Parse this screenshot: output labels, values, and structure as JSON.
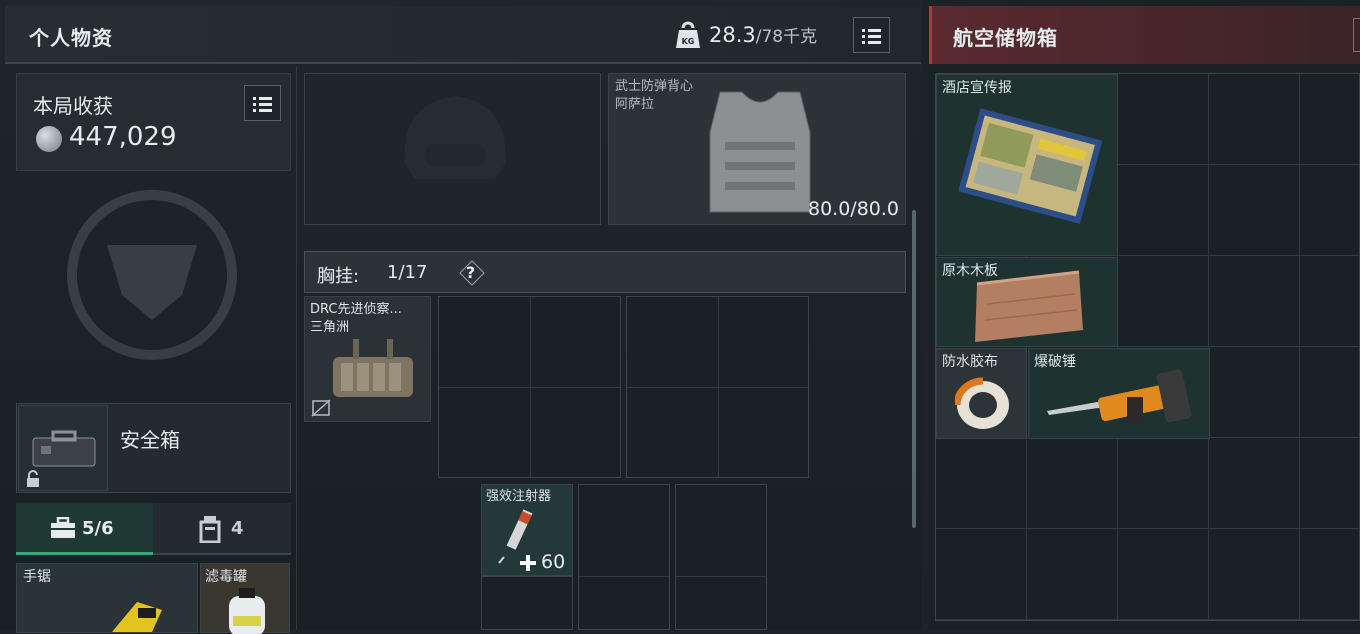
{
  "personal": {
    "title": "个人物资",
    "weight_current": "28.3",
    "weight_max": "/78千克",
    "kg_badge": "KG"
  },
  "harvest": {
    "label": "本局收获",
    "value": "447,029"
  },
  "helmet_slot": {
    "empty": true
  },
  "armor": {
    "name": "武士防弹背心",
    "map": "阿萨拉",
    "durability": "80.0/80.0"
  },
  "chest_rig": {
    "label": "胸挂:",
    "capacity": "1/17",
    "help": "?",
    "item_name": "DRC先进侦察...",
    "item_map": "三角洲"
  },
  "safe_box": {
    "label": "安全箱"
  },
  "tabs": [
    {
      "label": "5/6",
      "icon": "toolbox-icon",
      "active": true
    },
    {
      "label": "4",
      "icon": "canister-icon",
      "active": false
    }
  ],
  "pocket_items": [
    {
      "name": "手锯"
    },
    {
      "name": "滤毒罐"
    }
  ],
  "injector": {
    "name": "强效注射器",
    "value": "60"
  },
  "storage": {
    "title": "航空储物箱",
    "items": [
      {
        "name": "酒店宣传报"
      },
      {
        "name": "原木木板"
      },
      {
        "name": "防水胶布"
      },
      {
        "name": "爆破锤"
      }
    ]
  },
  "colors": {
    "accent_red": "#7a2f33",
    "active_tab": "#1f3a34",
    "tab_underline": "#3fa37d"
  }
}
